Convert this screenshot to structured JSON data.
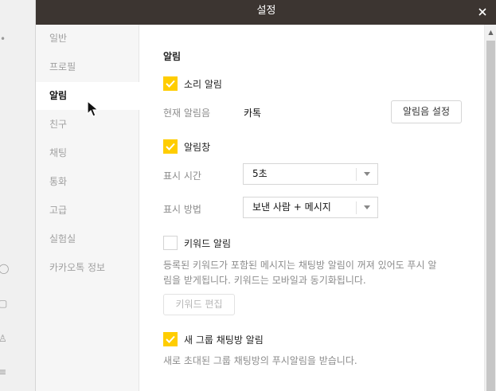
{
  "window": {
    "title": "설정"
  },
  "background_glyphs": [
    "•",
    "◯",
    "▢",
    "♙",
    "≡"
  ],
  "sidebar": {
    "items": [
      {
        "label": "일반",
        "active": false
      },
      {
        "label": "프로필",
        "active": false
      },
      {
        "label": "알림",
        "active": true
      },
      {
        "label": "친구",
        "active": false
      },
      {
        "label": "채팅",
        "active": false
      },
      {
        "label": "통화",
        "active": false
      },
      {
        "label": "고급",
        "active": false
      },
      {
        "label": "실험실",
        "active": false
      },
      {
        "label": "카카오톡 정보",
        "active": false
      }
    ]
  },
  "content": {
    "section_title": "알림",
    "sound_alert": {
      "label": "소리 알림",
      "checked": true
    },
    "current_sound": {
      "label": "현재 알림음",
      "value": "카톡",
      "button": "알림음 설정"
    },
    "alert_window": {
      "label": "알림창",
      "checked": true
    },
    "display_time": {
      "label": "표시 시간",
      "value": "5초"
    },
    "display_method": {
      "label": "표시 방법",
      "value": "보낸 사람 + 메시지"
    },
    "keyword_alert": {
      "label": "키워드 알림",
      "checked": false,
      "desc_line1": "등록된 키워드가 포함된 메시지는 채팅방 알림이 꺼져 있어도 푸시 알",
      "desc_line2": "림을 받게됩니다. 키워드는 모바일과 동기화됩니다.",
      "button": "키워드 편집"
    },
    "new_group_alert": {
      "label": "새 그룹 채팅방 알림",
      "checked": true,
      "desc": "새로 초대된 그룹 채팅방의 푸시알림을 받습니다."
    }
  },
  "colors": {
    "titlebar": "#3c3531",
    "checkbox_on": "#ffcd00",
    "sidebar_bg": "#f6f6f6"
  }
}
